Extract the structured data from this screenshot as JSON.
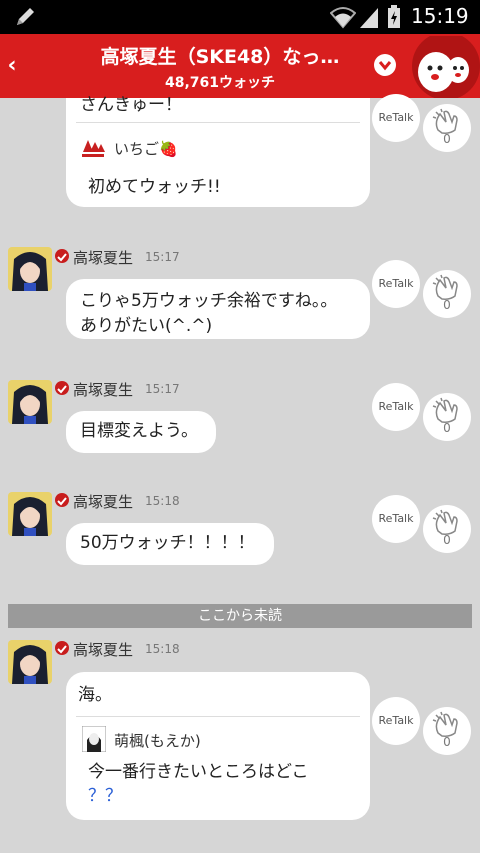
{
  "status": {
    "time": "15:19"
  },
  "header": {
    "title": "高塚夏生（SKE48）なっ…",
    "watch_count": "48,761ウォッチ"
  },
  "messages": [
    {
      "name": "",
      "text": "さんきゅー！",
      "quote": {
        "name": "いちご🍓",
        "text": "初めてウォッチ!!"
      },
      "retalk": "ReTalk",
      "watch": "0"
    },
    {
      "name": "高塚夏生",
      "time": "15:17",
      "text": "こりゃ5万ウォッチ余裕ですね。。\nありがたい(^.^)",
      "retalk": "ReTalk",
      "watch": "0"
    },
    {
      "name": "高塚夏生",
      "time": "15:17",
      "text": "目標変えよう。",
      "retalk": "ReTalk",
      "watch": "0"
    },
    {
      "name": "高塚夏生",
      "time": "15:18",
      "text": "50万ウォッチ！！！！",
      "retalk": "ReTalk",
      "watch": "0"
    },
    {
      "name": "高塚夏生",
      "time": "15:18",
      "text": "海。",
      "quote": {
        "name": "萌楓(もえか)",
        "text": "今一番行きたいところはどこ",
        "text2": "？？"
      },
      "retalk": "ReTalk",
      "watch": "0"
    }
  ],
  "divider": "ここから未読",
  "icons": {
    "status": [
      "pencil-icon",
      "wifi-icon",
      "signal-icon",
      "battery-charging-icon"
    ],
    "header": [
      "back-icon",
      "dropdown-icon",
      "mascot-icon"
    ],
    "message": [
      "verified-check-icon",
      "clap-icon"
    ]
  },
  "colors": {
    "header": "#d81e1e",
    "background": "#d6d6d6",
    "question_mark": "#2a5fd6"
  }
}
